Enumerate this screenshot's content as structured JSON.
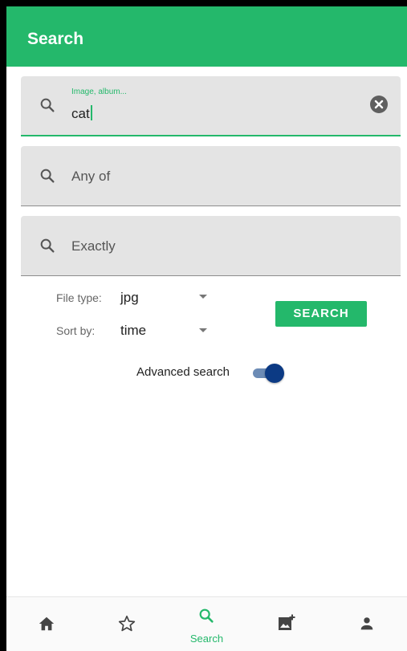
{
  "app_bar": {
    "title": "Search"
  },
  "search_fields": {
    "main": {
      "floating_label": "Image, album...",
      "value": "cat"
    },
    "any_of": {
      "placeholder": "Any of"
    },
    "exactly": {
      "placeholder": "Exactly"
    }
  },
  "filters": {
    "file_type_label": "File type:",
    "file_type_value": "jpg",
    "sort_by_label": "Sort by:",
    "sort_by_value": "time"
  },
  "search_button_label": "SEARCH",
  "advanced_search": {
    "label": "Advanced search",
    "enabled": true
  },
  "bottom_nav": {
    "items": [
      {
        "icon": "home-icon",
        "label": ""
      },
      {
        "icon": "star-icon",
        "label": ""
      },
      {
        "icon": "search-icon",
        "label": "Search",
        "active": true
      },
      {
        "icon": "add-photo-icon",
        "label": ""
      },
      {
        "icon": "person-icon",
        "label": ""
      }
    ]
  },
  "colors": {
    "accent": "#24b86b",
    "toggle_thumb": "#0c3a84",
    "toggle_track": "#6c8bb5",
    "field_bg": "#e4e4e4"
  }
}
